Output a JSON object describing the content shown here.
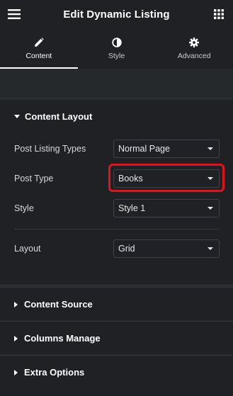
{
  "header": {
    "title": "Edit Dynamic Listing",
    "menu_icon": "hamburger-icon",
    "apps_icon": "grid-icon"
  },
  "tabs": [
    {
      "label": "Content",
      "icon": "pencil-icon",
      "active": true
    },
    {
      "label": "Style",
      "icon": "half-circle-icon",
      "active": false
    },
    {
      "label": "Advanced",
      "icon": "gear-icon",
      "active": false
    }
  ],
  "content_layout": {
    "title": "Content Layout",
    "fields": [
      {
        "label": "Post Listing Types",
        "value": "Normal Page"
      },
      {
        "label": "Post Type",
        "value": "Books"
      },
      {
        "label": "Style",
        "value": "Style 1"
      },
      {
        "label": "Layout",
        "value": "Grid"
      }
    ]
  },
  "sections": [
    {
      "title": "Content Source"
    },
    {
      "title": "Columns Manage"
    },
    {
      "title": "Extra Options"
    }
  ],
  "colors": {
    "highlight": "#e0121b",
    "panel": "#1f2124",
    "background": "#26292c"
  }
}
